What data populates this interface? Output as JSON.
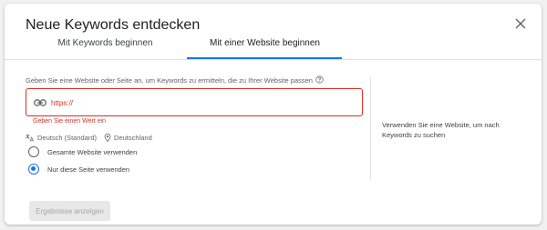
{
  "dialog": {
    "title": "Neue Keywords entdecken",
    "close_icon": "close-icon"
  },
  "tabs": [
    {
      "label": "Mit Keywords beginnen",
      "active": false
    },
    {
      "label": "Mit einer Website beginnen",
      "active": true
    }
  ],
  "form": {
    "prompt": "Geben Sie eine Website oder Seite an, um Keywords zu ermitteln, die zu Ihrer Website passen",
    "help_icon": "help-circle-icon",
    "url_icon": "link-icon",
    "url_placeholder": "https://",
    "url_value": "",
    "error": "Geben Sie einen Wert ein",
    "language_icon": "translate-icon",
    "language": "Deutsch (Standard)",
    "location_icon": "location-pin-icon",
    "location": "Deutschland",
    "radio_options": [
      {
        "label": "Gesamte Website verwenden",
        "checked": false
      },
      {
        "label": "Nur diese Seite verwenden",
        "checked": true
      }
    ]
  },
  "side_note": "Verwenden Sie eine Website, um nach Keywords zu suchen",
  "submit_label": "Ergebnisse anzeigen",
  "colors": {
    "accent": "#1a73e8",
    "error": "#d93025",
    "disabled_bg": "#e8e8e8",
    "disabled_text": "#a6a6a6"
  }
}
